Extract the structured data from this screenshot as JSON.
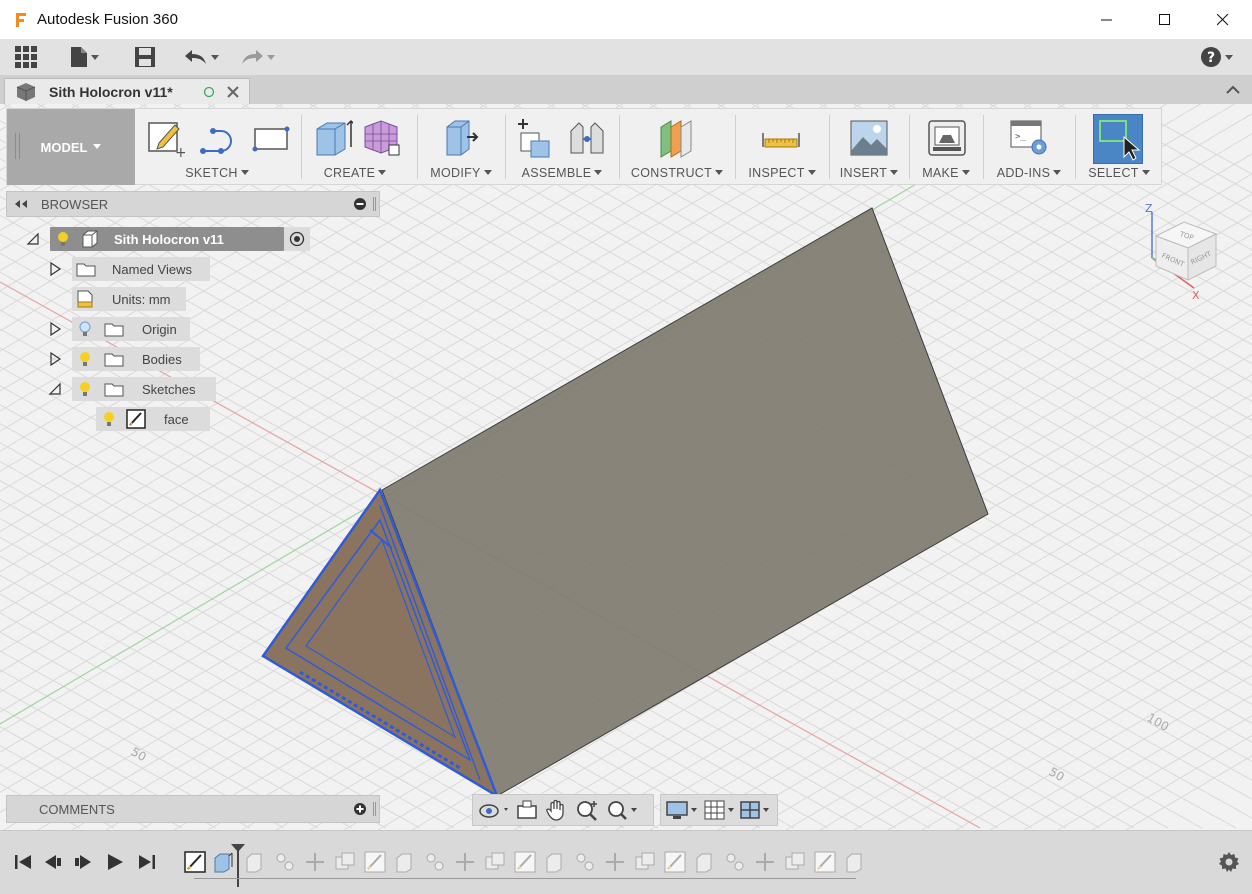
{
  "window": {
    "app_title": "Autodesk Fusion 360"
  },
  "document_tab": {
    "label": "Sith Holocron v11*"
  },
  "toolbar": {
    "workspace_label": "MODEL",
    "groups": [
      {
        "label": "SKETCH"
      },
      {
        "label": "CREATE"
      },
      {
        "label": "MODIFY"
      },
      {
        "label": "ASSEMBLE"
      },
      {
        "label": "CONSTRUCT"
      },
      {
        "label": "INSPECT"
      },
      {
        "label": "INSERT"
      },
      {
        "label": "MAKE"
      },
      {
        "label": "ADD-INS"
      },
      {
        "label": "SELECT"
      }
    ]
  },
  "browser": {
    "title": "BROWSER",
    "root": "Sith Holocron v11",
    "items": [
      {
        "label": "Named Views"
      },
      {
        "label": "Units: mm"
      },
      {
        "label": "Origin"
      },
      {
        "label": "Bodies"
      },
      {
        "label": "Sketches"
      },
      {
        "label": "face"
      }
    ]
  },
  "comments": {
    "title": "COMMENTS"
  },
  "viewcube": {
    "top": "TOP",
    "front": "FRONT",
    "right": "RIGHT",
    "axis_z": "Z",
    "axis_x": "X"
  },
  "grid_labels": {
    "l50": "50",
    "r100": "100",
    "r50": "50"
  },
  "colors": {
    "accent_blue": "#2f5bd8",
    "model_gray": "#7f7b70",
    "select_active": "#4a86c5"
  }
}
